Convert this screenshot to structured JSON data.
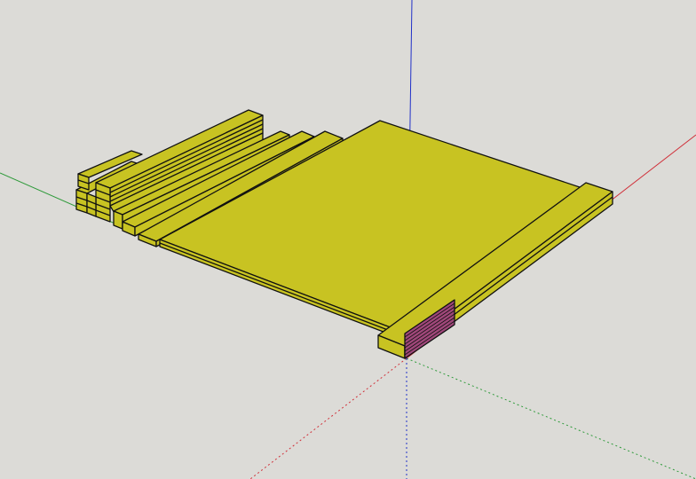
{
  "scene": {
    "background": "#dcdbd7",
    "face_color": "#c8c322",
    "face_shadow_color": "#bdb81d",
    "edge_color": "#111111",
    "back_face_color": "#a0477a",
    "axis_colors": {
      "red": "#d0303a",
      "green": "#2e9a3a",
      "blue": "#2030c8"
    }
  }
}
